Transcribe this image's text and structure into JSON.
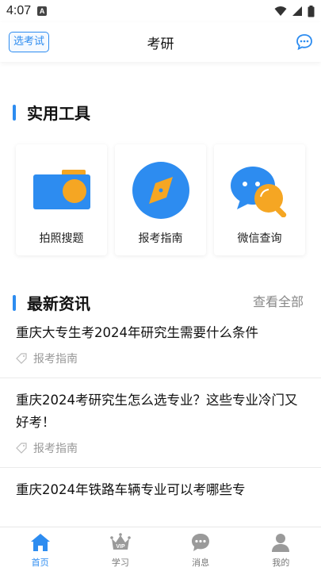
{
  "status_bar": {
    "time": "4:07",
    "notif_letter": "A"
  },
  "header": {
    "exam_select_label": "选考试",
    "title": "考研"
  },
  "tools_section": {
    "title": "实用工具",
    "items": [
      {
        "label": "拍照搜题",
        "icon": "camera-icon"
      },
      {
        "label": "报考指南",
        "icon": "compass-icon"
      },
      {
        "label": "微信查询",
        "icon": "wechat-search-icon"
      }
    ]
  },
  "news_section": {
    "title": "最新资讯",
    "view_all": "查看全部",
    "items": [
      {
        "title": "重庆大专生考2024年研究生需要什么条件",
        "tag": "报考指南"
      },
      {
        "title": "重庆2024考研究生怎么选专业？这些专业冷门又好考！",
        "tag": "报考指南"
      },
      {
        "title": "重庆2024年铁路车辆专业可以考哪些专",
        "tag": ""
      }
    ]
  },
  "bottom_nav": {
    "items": [
      {
        "label": "首页",
        "icon": "home-icon",
        "active": true
      },
      {
        "label": "学习",
        "icon": "vip-crown-icon",
        "active": false
      },
      {
        "label": "消息",
        "icon": "message-icon",
        "active": false
      },
      {
        "label": "我的",
        "icon": "user-icon",
        "active": false
      }
    ]
  },
  "colors": {
    "accent": "#2d8cf0",
    "orange": "#f5a623",
    "muted": "#999999"
  }
}
